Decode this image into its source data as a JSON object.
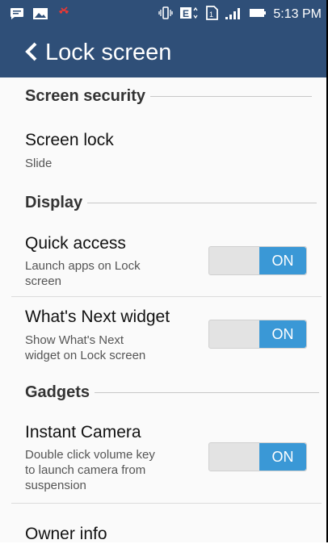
{
  "status_bar": {
    "time": "5:13 PM",
    "icons": [
      "message-icon",
      "image-icon",
      "missed-call-icon",
      "vibrate-icon",
      "data-e-icon",
      "sim-icon",
      "signal-icon",
      "battery-icon"
    ]
  },
  "app_bar": {
    "title": "Lock screen"
  },
  "sections": {
    "screen_security": "Screen security",
    "display": "Display",
    "gadgets": "Gadgets"
  },
  "items": {
    "screen_lock": {
      "title": "Screen lock",
      "subtitle": "Slide"
    },
    "quick_access": {
      "title": "Quick access",
      "subtitle_line1": "Launch apps on Lock",
      "subtitle_line2": "screen",
      "toggle": "ON"
    },
    "whats_next": {
      "title": "What's Next widget",
      "subtitle_line1": "Show What's Next",
      "subtitle_line2": "widget on Lock screen",
      "toggle": "ON"
    },
    "instant_camera": {
      "title": "Instant Camera",
      "subtitle_line1": "Double click volume key",
      "subtitle_line2": "to launch camera from",
      "subtitle_line3": "suspension",
      "toggle": "ON"
    },
    "owner_info": {
      "title": "Owner info"
    }
  },
  "colors": {
    "bar": "#2f4f78",
    "toggle_on": "#3a98d6",
    "missed_call": "#e53935"
  }
}
